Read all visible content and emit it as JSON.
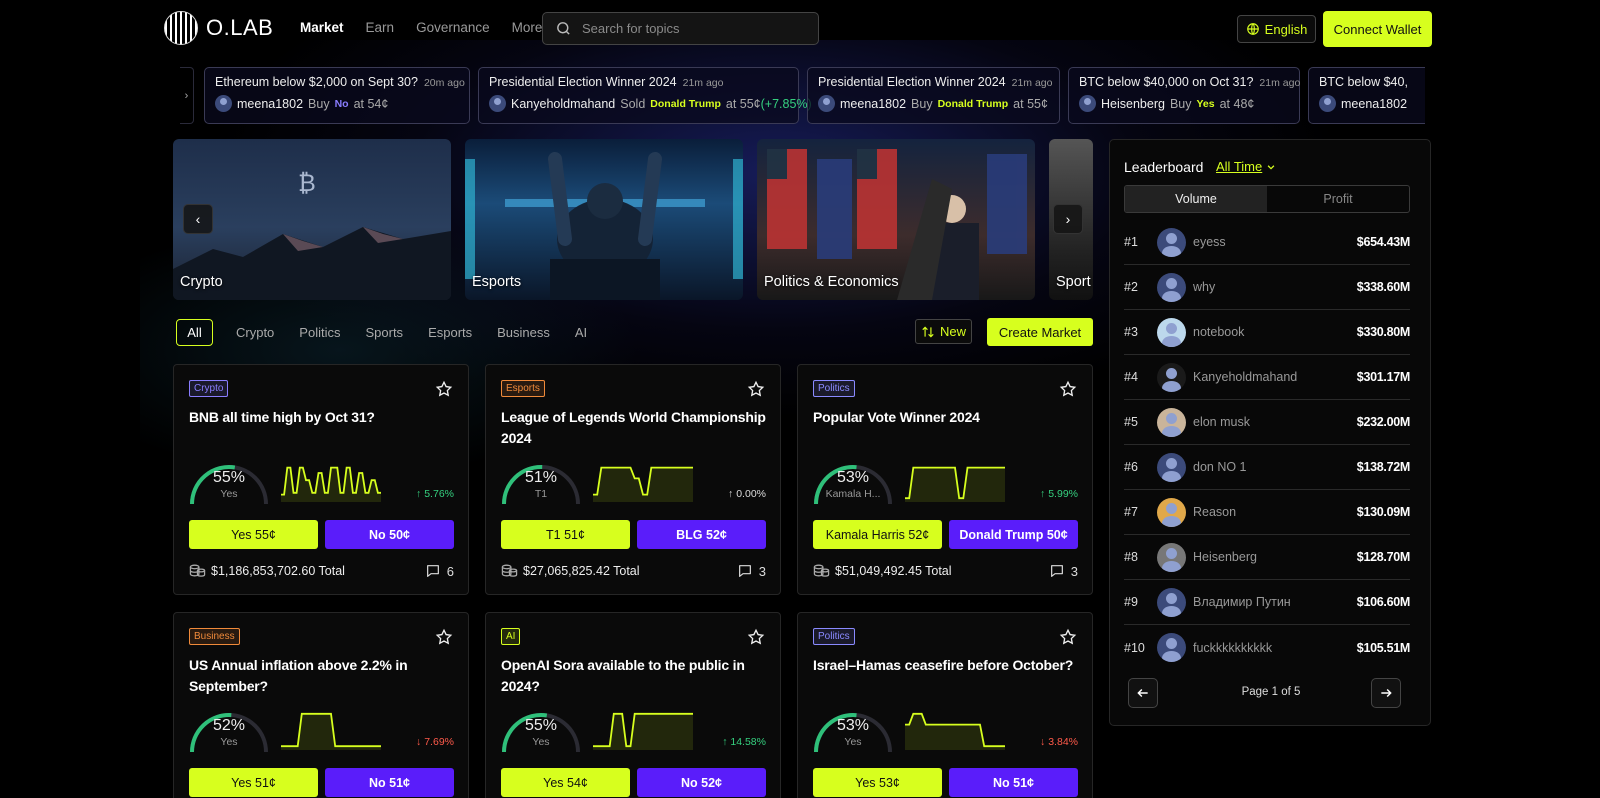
{
  "header": {
    "logo_text": "O.LAB",
    "nav": [
      "Market",
      "Earn",
      "Governance",
      "More"
    ],
    "active_nav": "Market",
    "search_placeholder": "Search for topics",
    "language": "English",
    "connect_label": "Connect Wallet"
  },
  "ticker": [
    {
      "title": "Ethereum below $2,000 on Sept 30?",
      "time": "20m ago",
      "user": "meena1802",
      "action": "Buy",
      "outcome": "No",
      "outcome_color": "#8a7dff",
      "price": "at 54¢",
      "change": ""
    },
    {
      "title": "Presidential Election Winner 2024",
      "time": "21m ago",
      "user": "Kanyeholdmahand",
      "action": "Sold",
      "outcome": "Donald Trump",
      "outcome_color": "#d7ff1e",
      "price": "at 55¢",
      "change": "(+7.85%)"
    },
    {
      "title": "Presidential Election Winner 2024",
      "time": "21m ago",
      "user": "meena1802",
      "action": "Buy",
      "outcome": "Donald Trump",
      "outcome_color": "#d7ff1e",
      "price": "at 55¢",
      "change": ""
    },
    {
      "title": "BTC below $40,000 on Oct 31?",
      "time": "21m ago",
      "user": "Heisenberg",
      "action": "Buy",
      "outcome": "Yes",
      "outcome_color": "#d7ff1e",
      "price": "at 48¢",
      "change": ""
    },
    {
      "title": "BTC below $40,",
      "time": "",
      "user": "meena1802",
      "action": "",
      "outcome": "",
      "outcome_color": "#d7ff1e",
      "price": "",
      "change": ""
    }
  ],
  "banners": [
    "Crypto",
    "Esports",
    "Politics & Economics",
    "Sport"
  ],
  "filters": {
    "tabs": [
      "All",
      "Crypto",
      "Politics",
      "Sports",
      "Esports",
      "Business",
      "AI"
    ],
    "new_label": "New",
    "create_label": "Create Market"
  },
  "cards": [
    {
      "tag": "Crypto",
      "tag_color": "#8a7dff",
      "title": "BNB all time high by Oct 31?",
      "pct": "55%",
      "pct_value": 0.55,
      "label": "Yes",
      "change": "5.76%",
      "dir": "up",
      "yes": "Yes 55¢",
      "no": "No 50¢",
      "total": "$1,186,853,702.60 Total",
      "comments": "6",
      "spark": [
        0.15,
        0.15,
        0.9,
        0.9,
        0.2,
        0.2,
        0.9,
        0.9,
        0.55,
        0.55,
        0.2,
        0.2,
        0.75,
        0.75,
        0.2,
        0.2,
        0.9,
        0.9,
        0.9,
        0.2,
        0.2,
        0.9,
        0.9,
        0.2,
        0.2,
        0.75,
        0.75,
        0.2,
        0.2,
        0.55,
        0.55,
        0.2,
        0.2
      ]
    },
    {
      "tag": "Esports",
      "tag_color": "#f08a3a",
      "title": "League of Legends World Championship 2024",
      "pct": "51%",
      "pct_value": 0.51,
      "label": "T1",
      "change": "0.00%",
      "dir": "flat",
      "yes": "T1 51¢",
      "no": "BLG 52¢",
      "total": "$27,065,825.42 Total",
      "comments": "3",
      "spark": [
        0.15,
        0.15,
        0.9,
        0.9,
        0.9,
        0.9,
        0.9,
        0.9,
        0.9,
        0.9,
        0.6,
        0.6,
        0.15,
        0.15,
        0.9,
        0.9,
        0.9,
        0.9,
        0.9,
        0.9,
        0.9,
        0.9,
        0.9,
        0.9,
        0.9
      ]
    },
    {
      "tag": "Politics",
      "tag_color": "#8a8aff",
      "title": "Popular Vote Winner 2024",
      "pct": "53%",
      "pct_value": 0.53,
      "label": "Kamala H...",
      "change": "5.99%",
      "dir": "up",
      "yes": "Kamala Harris 52¢",
      "no": "Donald Trump 50¢",
      "total": "$51,049,492.45 Total",
      "comments": "3",
      "spark": [
        0.05,
        0.05,
        0.9,
        0.9,
        0.9,
        0.9,
        0.9,
        0.9,
        0.9,
        0.9,
        0.9,
        0.9,
        0.9,
        0.05,
        0.05,
        0.9,
        0.9,
        0.9,
        0.9,
        0.9,
        0.9,
        0.9,
        0.9,
        0.9,
        0.9
      ]
    },
    {
      "tag": "Business",
      "tag_color": "#f08a3a",
      "title": "US Annual inflation above 2.2% in September?",
      "pct": "52%",
      "pct_value": 0.52,
      "label": "Yes",
      "change": "7.69%",
      "dir": "down",
      "yes": "Yes 51¢",
      "no": "No 51¢",
      "total": "",
      "comments": "",
      "spark": [
        0.05,
        0.05,
        0.05,
        0.05,
        0.05,
        0.95,
        0.95,
        0.95,
        0.95,
        0.95,
        0.95,
        0.95,
        0.95,
        0.05,
        0.05,
        0.05,
        0.05,
        0.05,
        0.05,
        0.05,
        0.05,
        0.05,
        0.05,
        0.05,
        0.05
      ]
    },
    {
      "tag": "AI",
      "tag_color": "#d7ff1e",
      "title": "OpenAI Sora available to the public in 2024?",
      "pct": "55%",
      "pct_value": 0.55,
      "label": "Yes",
      "change": "14.58%",
      "dir": "up",
      "yes": "Yes 54¢",
      "no": "No 52¢",
      "total": "",
      "comments": "",
      "spark": [
        0.05,
        0.05,
        0.05,
        0.05,
        0.05,
        0.95,
        0.95,
        0.95,
        0.05,
        0.05,
        0.95,
        0.95,
        0.95,
        0.95,
        0.95,
        0.95,
        0.95,
        0.95,
        0.95,
        0.95,
        0.95,
        0.95,
        0.95,
        0.95,
        0.95
      ]
    },
    {
      "tag": "Politics",
      "tag_color": "#8a8aff",
      "title": "Israel–Hamas ceasefire before October?",
      "pct": "53%",
      "pct_value": 0.53,
      "label": "Yes",
      "change": "3.84%",
      "dir": "down",
      "yes": "Yes 53¢",
      "no": "No 51¢",
      "total": "",
      "comments": "",
      "spark": [
        0.65,
        0.65,
        0.95,
        0.95,
        0.95,
        0.65,
        0.65,
        0.65,
        0.65,
        0.65,
        0.65,
        0.65,
        0.65,
        0.65,
        0.65,
        0.65,
        0.65,
        0.65,
        0.65,
        0.05,
        0.05,
        0.05,
        0.05,
        0.05,
        0.05
      ]
    }
  ],
  "leaderboard": {
    "title": "Leaderboard",
    "period": "All Time",
    "tabs": [
      "Volume",
      "Profit"
    ],
    "rows": [
      {
        "rank": "#1",
        "name": "eyess",
        "value": "$654.43M",
        "avatar": "default"
      },
      {
        "rank": "#2",
        "name": "why",
        "value": "$338.60M",
        "avatar": "default"
      },
      {
        "rank": "#3",
        "name": "notebook",
        "value": "$330.80M",
        "avatar": "light"
      },
      {
        "rank": "#4",
        "name": "Kanyeholdmahand",
        "value": "$301.17M",
        "avatar": "dark"
      },
      {
        "rank": "#5",
        "name": "elon musk",
        "value": "$232.00M",
        "avatar": "face"
      },
      {
        "rank": "#6",
        "name": "don NO 1",
        "value": "$138.72M",
        "avatar": "default"
      },
      {
        "rank": "#7",
        "name": "Reason",
        "value": "$130.09M",
        "avatar": "dog"
      },
      {
        "rank": "#8",
        "name": "Heisenberg",
        "value": "$128.70M",
        "avatar": "bw"
      },
      {
        "rank": "#9",
        "name": "Владимир Путин",
        "value": "$106.60M",
        "avatar": "default"
      },
      {
        "rank": "#10",
        "name": "fuckkkkkkkkkk",
        "value": "$105.51M",
        "avatar": "default"
      }
    ],
    "page_text": "Page 1 of 5"
  },
  "colors": {
    "accent": "#d7ff1e",
    "no_purple": "#5a1dfa",
    "up": "#35d07f",
    "down": "#ff5a4a"
  }
}
